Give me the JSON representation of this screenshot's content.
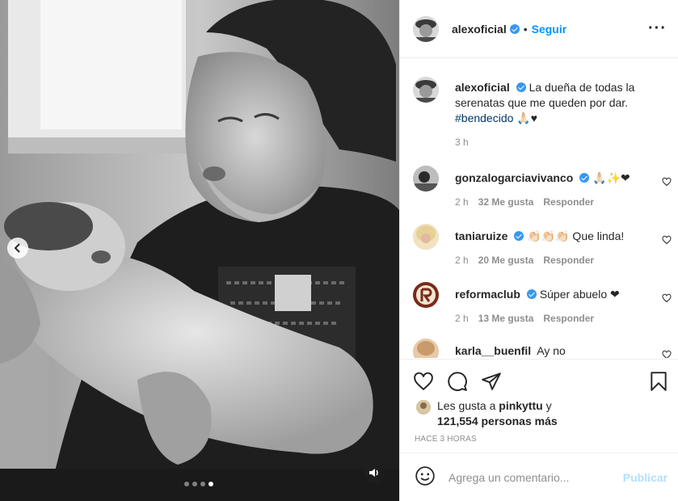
{
  "post": {
    "author": "alexoficial",
    "follow_label": "Seguir",
    "more_label": "···",
    "dots_total": 4,
    "dots_active": 4
  },
  "caption": {
    "username": "alexoficial",
    "text": "La dueña de todas la serenatas que me queden por dar.",
    "hashtag": "#bendecido",
    "emoji": "🙏🏻♥",
    "time": "3 h"
  },
  "comments": [
    {
      "username": "gonzalogarciavivanco",
      "text": "🙏🏻✨❤",
      "time": "2 h",
      "likes": "32 Me gusta",
      "reply": "Responder"
    },
    {
      "username": "taniaruize",
      "text": "👏🏻👏🏻👏🏻 Que linda!",
      "time": "2 h",
      "likes": "20 Me gusta",
      "reply": "Responder"
    },
    {
      "username": "reformaclub",
      "text": "Súper abuelo ❤",
      "time": "2 h",
      "likes": "13 Me gusta",
      "reply": "Responder"
    },
    {
      "username": "karla__buenfil",
      "text": "Ay no",
      "time": "",
      "likes": "",
      "reply": ""
    }
  ],
  "likes": {
    "prefix": "Les gusta a",
    "user": "pinkyttu",
    "and": "y",
    "others": "121,554 personas más"
  },
  "time_ago": "HACE 3 HORAS",
  "comment_box": {
    "placeholder": "Agrega un comentario...",
    "publish_label": "Publicar"
  },
  "icons": {
    "like": "heart-icon",
    "comment": "comment-icon",
    "share": "share-icon",
    "save": "bookmark-icon",
    "emoji": "emoji-icon",
    "sound": "speaker-icon",
    "prev": "chevron-left-icon"
  },
  "colors": {
    "accent": "#0095f6",
    "verified": "#3897f0",
    "muted": "#8e8e8e",
    "publish_disabled": "#b2dffc"
  }
}
